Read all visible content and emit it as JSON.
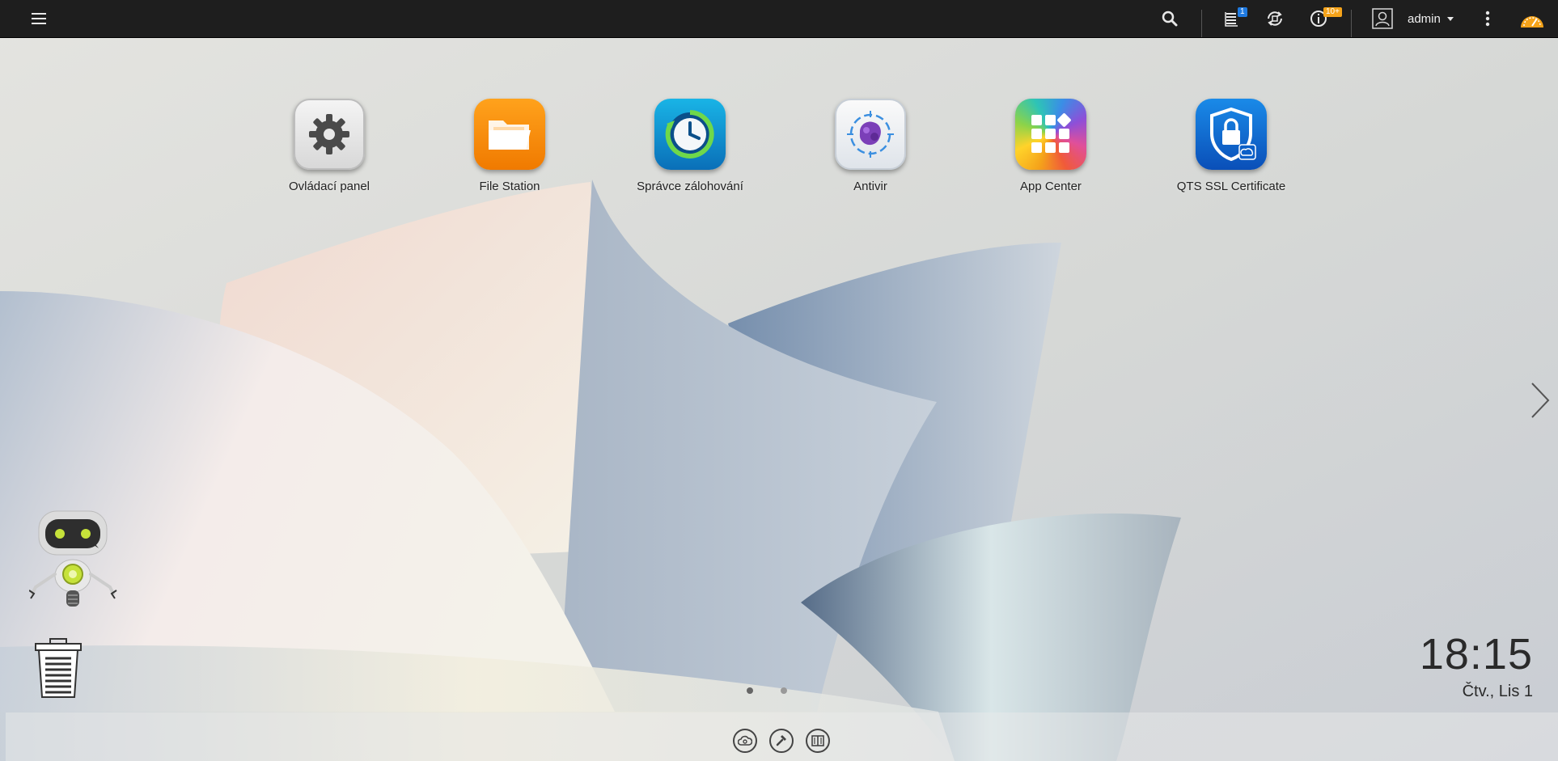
{
  "topbar": {
    "menu_icon": "hamburger-icon",
    "search_icon": "search-icon",
    "tasks_badge": "1",
    "notifications_badge": "10+",
    "user_name": "admin"
  },
  "desktop": {
    "apps": [
      {
        "label": "Ovládací panel",
        "icon": "gear-icon"
      },
      {
        "label": "File Station",
        "icon": "folder-icon"
      },
      {
        "label": "Správce zálohování",
        "icon": "backup-clock-icon"
      },
      {
        "label": "Antivir",
        "icon": "antivirus-icon"
      },
      {
        "label": "App Center",
        "icon": "app-grid-icon"
      },
      {
        "label": "QTS SSL Certificate",
        "icon": "shield-lock-icon"
      }
    ]
  },
  "clock": {
    "time": "18:15",
    "date": "Čtv., Lis 1"
  },
  "pager": {
    "current": 1,
    "total": 2
  },
  "colors": {
    "topbar": "#1e1e1e",
    "accent_orange": "#f5a31a",
    "badge_blue": "#1f7ae0"
  }
}
